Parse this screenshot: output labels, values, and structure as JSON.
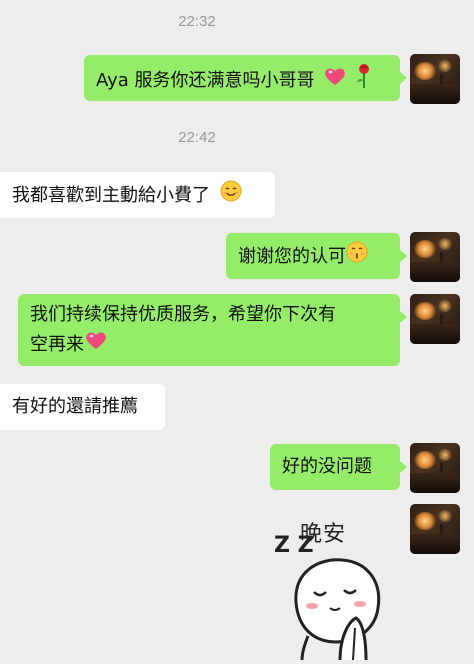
{
  "chat": {
    "timestamps": [
      "22:32",
      "22:42"
    ],
    "messages": [
      {
        "side": "out",
        "text": "Aya 服务你还满意吗小哥哥"
      },
      {
        "side": "in",
        "text": "我都喜歡到主動給小費了"
      },
      {
        "side": "out",
        "text": "谢谢您的认可"
      },
      {
        "side": "out",
        "line1": "我们持续保持优质服务，希望你下次有",
        "line2": "空再来"
      },
      {
        "side": "in",
        "text": "有好的還請推薦"
      },
      {
        "side": "out",
        "text": "好的没问题"
      }
    ],
    "sticker": {
      "text": "晚安",
      "zz": "Z Z"
    }
  },
  "icons": {
    "heart": "heart-icon",
    "rose": "rose-icon",
    "smile": "smile-icon",
    "kiss": "kiss-icon"
  },
  "colors": {
    "background": "#ededed",
    "outgoing_bubble": "#95ec69",
    "incoming_bubble": "#ffffff",
    "heart": "#f0487a"
  }
}
